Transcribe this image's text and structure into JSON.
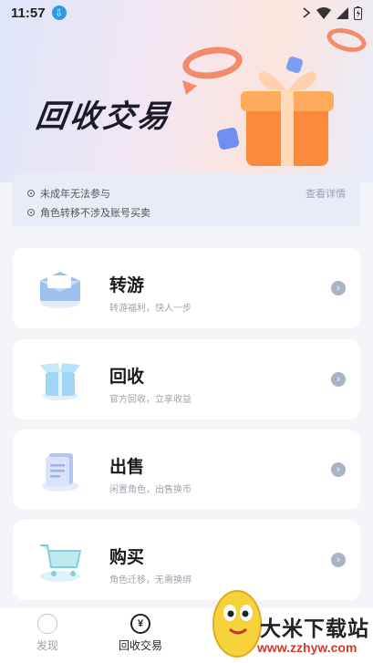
{
  "status_bar": {
    "time": "11:57"
  },
  "banner": {
    "title": "回收交易"
  },
  "notice": {
    "lines": [
      "未成年无法参与",
      "角色转移不涉及账号买卖"
    ],
    "link": "查看详情"
  },
  "cards": [
    {
      "title": "转游",
      "subtitle": "转游福利，快人一步",
      "icon": "envelope-icon"
    },
    {
      "title": "回收",
      "subtitle": "官方回收，立享收益",
      "icon": "box-icon"
    },
    {
      "title": "出售",
      "subtitle": "闲置角色，出售换币",
      "icon": "document-icon"
    },
    {
      "title": "购买",
      "subtitle": "角色迁移，无需换绑",
      "icon": "cart-icon"
    }
  ],
  "tabbar": {
    "tabs": [
      {
        "label": "发现",
        "icon": "discover-icon",
        "active": false
      },
      {
        "label": "回收交易",
        "icon": "yen-icon",
        "icon_text": "¥",
        "active": true
      }
    ]
  },
  "watermark": {
    "text": "大米下载站",
    "url": "www.zzhyw.com"
  },
  "colors": {
    "accent": "#f38a6a",
    "arrow": "#aab3c6",
    "text_muted": "#a0a3ad"
  }
}
